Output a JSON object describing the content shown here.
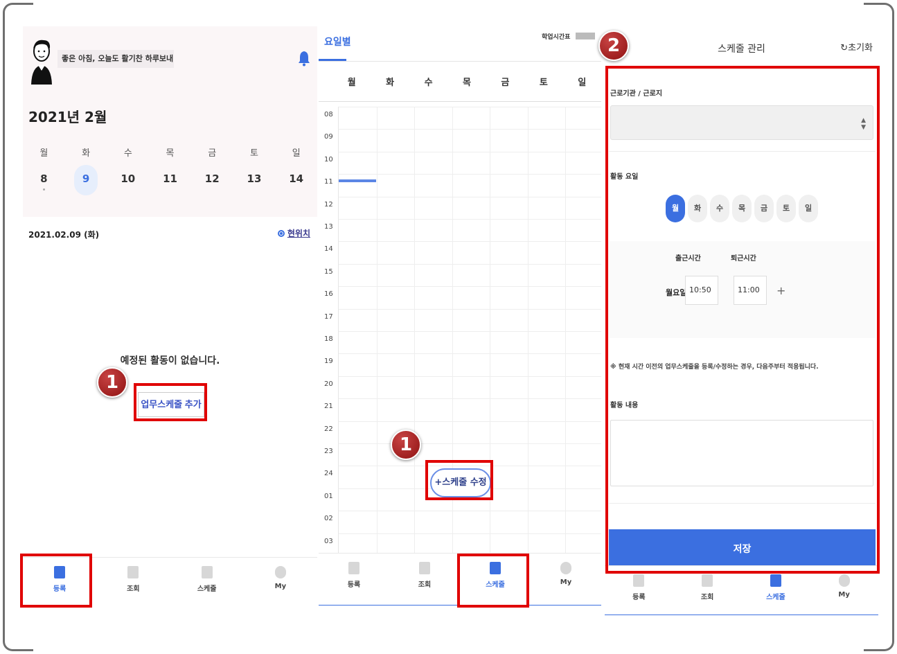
{
  "panel1": {
    "greeting": "좋은 아침, 오늘도 활기찬 하루보내",
    "month_title": "2021년 2월",
    "week_days": [
      "월",
      "화",
      "수",
      "목",
      "금",
      "토",
      "일"
    ],
    "week_dates": [
      "8",
      "9",
      "10",
      "11",
      "12",
      "13",
      "14"
    ],
    "selected_date": "2021.02.09 (화)",
    "current_location": "현위치",
    "empty_message": "예정된 활동이 없습니다.",
    "add_schedule_label": "업무스케줄 추가"
  },
  "panel2": {
    "tab_label": "요일별",
    "legend_label": "학업시간표",
    "day_headers": [
      "월",
      "화",
      "수",
      "목",
      "금",
      "토",
      "일"
    ],
    "hours": [
      "08",
      "09",
      "10",
      "11",
      "12",
      "13",
      "14",
      "15",
      "16",
      "17",
      "18",
      "19",
      "20",
      "21",
      "22",
      "23",
      "24",
      "01",
      "02",
      "03"
    ],
    "edit_button_label": "+스케줄 수정"
  },
  "panel3": {
    "title": "스케줄 관리",
    "reset_label": "초기화",
    "institution_label": "근로기관 / 근로지",
    "activity_days_label": "활동 요일",
    "activity_days": [
      "월",
      "화",
      "수",
      "목",
      "금",
      "토",
      "일"
    ],
    "start_time_label": "출근시간",
    "end_time_label": "퇴근시간",
    "day_row_label": "월요일",
    "start_time": "10:50",
    "end_time": "11:00",
    "notice": "※ 현재 시간 이전의 업무스케줄을 등록/수정하는 경우, 다음주부터 적용됩니다.",
    "activity_content_label": "활동 내용",
    "save_label": "저장"
  },
  "tabbar": {
    "register": "등록",
    "lookup": "조회",
    "schedule": "스케줄",
    "my": "My"
  },
  "badges": {
    "one": "1",
    "two": "2"
  },
  "colors": {
    "accent": "#3b6fe0",
    "highlight": "#e00000",
    "badge": "#a51d1d"
  }
}
